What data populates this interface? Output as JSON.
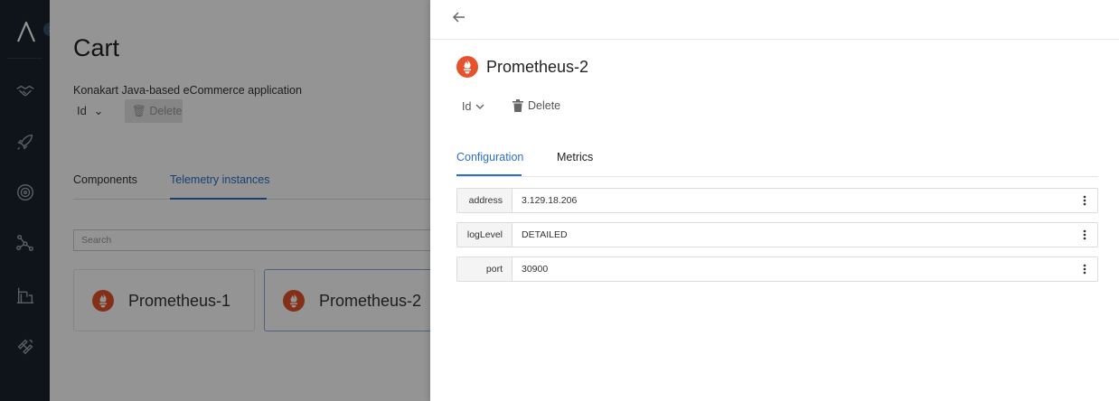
{
  "app": {
    "logo": "aperture-logo-icon"
  },
  "sidebar": {
    "items": [
      {
        "icon": "handshake-icon"
      },
      {
        "icon": "rocket-icon"
      },
      {
        "icon": "target-icon"
      },
      {
        "icon": "network-icon"
      },
      {
        "icon": "crane-icon"
      },
      {
        "icon": "satellite-icon"
      }
    ]
  },
  "page": {
    "title": "Cart",
    "description": "Konakart Java-based eCommerce application",
    "id_label": "Id",
    "delete_label": "Delete",
    "tabs": [
      {
        "label": "Components"
      },
      {
        "label": "Telemetry instances"
      }
    ],
    "search_placeholder": "Search",
    "cards": [
      {
        "label": "Prometheus-1"
      },
      {
        "label": "Prometheus-2"
      }
    ]
  },
  "drawer": {
    "title": "Prometheus-2",
    "id_label": "Id",
    "delete_label": "Delete",
    "tabs": [
      {
        "label": "Configuration"
      },
      {
        "label": "Metrics"
      }
    ],
    "properties": [
      {
        "key": "address",
        "value": "3.129.18.206"
      },
      {
        "key": "logLevel",
        "value": "DETAILED"
      },
      {
        "key": "port",
        "value": "30900"
      }
    ]
  },
  "colors": {
    "accent": "#2a6fc9",
    "prometheus": "#e6522c",
    "sidebar": "#1b2430"
  }
}
